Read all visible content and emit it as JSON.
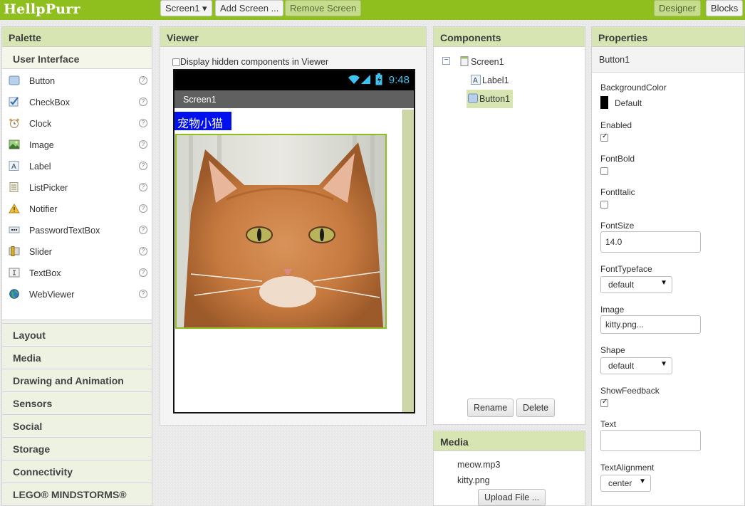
{
  "app": {
    "logo": "HellpPurr",
    "screen_selector": "Screen1 ▾",
    "add_screen": "Add Screen ...",
    "remove_screen": "Remove Screen",
    "designer": "Designer",
    "blocks": "Blocks"
  },
  "palette": {
    "title": "Palette",
    "open_category": "User Interface",
    "items": [
      {
        "label": "Button",
        "icon": "button-icon"
      },
      {
        "label": "CheckBox",
        "icon": "checkbox-icon"
      },
      {
        "label": "Clock",
        "icon": "clock-icon"
      },
      {
        "label": "Image",
        "icon": "image-icon"
      },
      {
        "label": "Label",
        "icon": "label-icon"
      },
      {
        "label": "ListPicker",
        "icon": "listpicker-icon"
      },
      {
        "label": "Notifier",
        "icon": "notifier-icon"
      },
      {
        "label": "PasswordTextBox",
        "icon": "password-icon"
      },
      {
        "label": "Slider",
        "icon": "slider-icon"
      },
      {
        "label": "TextBox",
        "icon": "textbox-icon"
      },
      {
        "label": "WebViewer",
        "icon": "webviewer-icon"
      }
    ],
    "help": "?",
    "categories": [
      "Layout",
      "Media",
      "Drawing and Animation",
      "Sensors",
      "Social",
      "Storage",
      "Connectivity",
      "LEGO® MINDSTORMS®"
    ]
  },
  "viewer": {
    "title": "Viewer",
    "hidden_option": "Display hidden components in Viewer",
    "time": "9:48",
    "screen_title": "Screen1",
    "label_text": "宠物小猫"
  },
  "components": {
    "title": "Components",
    "screen": "Screen1",
    "label": "Label1",
    "button": "Button1",
    "rename": "Rename",
    "delete": "Delete"
  },
  "media": {
    "title": "Media",
    "files": [
      "meow.mp3",
      "kitty.png"
    ],
    "upload": "Upload File ..."
  },
  "properties": {
    "title": "Properties",
    "component": "Button1",
    "background_color_label": "BackgroundColor",
    "background_color_value": "Default",
    "enabled_label": "Enabled",
    "fontbold_label": "FontBold",
    "fontitalic_label": "FontItalic",
    "fontsize_label": "FontSize",
    "fontsize_value": "14.0",
    "fonttypeface_label": "FontTypeface",
    "fonttypeface_value": "default",
    "image_label": "Image",
    "image_value": "kitty.png...",
    "shape_label": "Shape",
    "shape_value": "default",
    "showfeedback_label": "ShowFeedback",
    "text_label": "Text",
    "text_value": "",
    "textalignment_label": "TextAlignment",
    "textalignment_value": "center",
    "arrow": "▼"
  },
  "colors": {
    "topbar": "#8fbf1f",
    "panel_header": "#d6e5b2",
    "label_bg": "#0010ee",
    "status_time": "#3ec3f0"
  }
}
